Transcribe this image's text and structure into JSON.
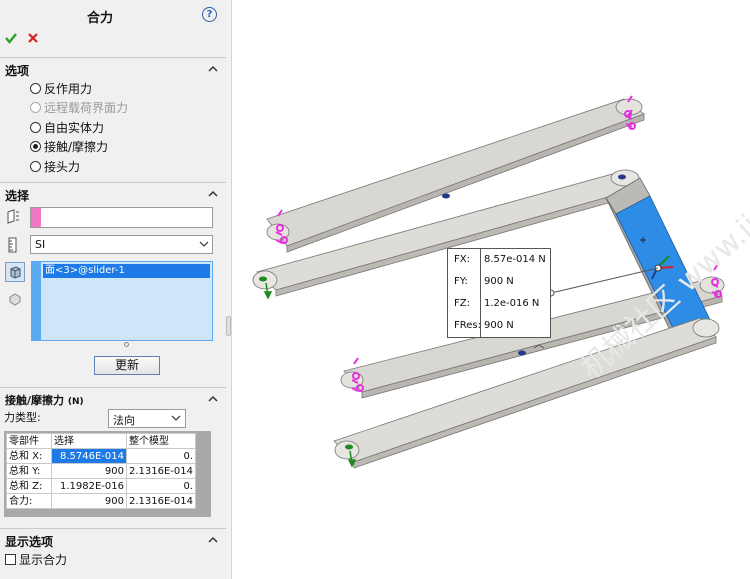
{
  "panel": {
    "title": "合力",
    "help_icon": "help-icon",
    "ok_icon": "check-icon",
    "cancel_icon": "close-icon",
    "options": {
      "title": "选项",
      "items": [
        {
          "label": "反作用力",
          "selected": false,
          "enabled": true
        },
        {
          "label": "远程载荷界面力",
          "selected": false,
          "enabled": false
        },
        {
          "label": "自由实体力",
          "selected": false,
          "enabled": true
        },
        {
          "label": "接触/摩擦力",
          "selected": true,
          "enabled": true
        },
        {
          "label": "接头力",
          "selected": false,
          "enabled": true
        }
      ]
    },
    "selection": {
      "title": "选择",
      "units_value": "SI",
      "list_item": "面<3>@slider-1",
      "update_button": "更新"
    },
    "contact": {
      "title": "接触/摩擦力",
      "title_suffix": "(N)",
      "force_type_label": "力类型:",
      "force_type_value": "法向",
      "table": {
        "headers": [
          "零部件",
          "选择",
          "整个模型"
        ],
        "rows": [
          {
            "label": "总和 X:",
            "selection": "8.5746E-014",
            "model": "0."
          },
          {
            "label": "总和 Y:",
            "selection": "900",
            "model": "2.1316E-014"
          },
          {
            "label": "总和 Z:",
            "selection": "1.1982E-016",
            "model": "0."
          },
          {
            "label": "合力:",
            "selection": "900",
            "model": "2.1316E-014"
          }
        ]
      }
    },
    "display": {
      "title": "显示选项",
      "show_resultant": "显示合力"
    }
  },
  "viewport": {
    "probe": [
      {
        "key": "FX:",
        "value": "8.57e-014 N"
      },
      {
        "key": "FY:",
        "value": "900 N"
      },
      {
        "key": "FZ:",
        "value": "1.2e-016 N"
      },
      {
        "key": "FRes:",
        "value": "900 N"
      }
    ],
    "watermark": "机械社区 www.jixie.com"
  },
  "colors": {
    "accent": "#1e7ae6",
    "selection_fill": "#cfe6fa",
    "list_selected": "#1e7ae6",
    "pink": "#e62fe0",
    "link_fill": "#d9d7d2",
    "slider_fill": "#2d8de6",
    "ok_green": "#27a527",
    "cancel_red": "#d42323"
  }
}
